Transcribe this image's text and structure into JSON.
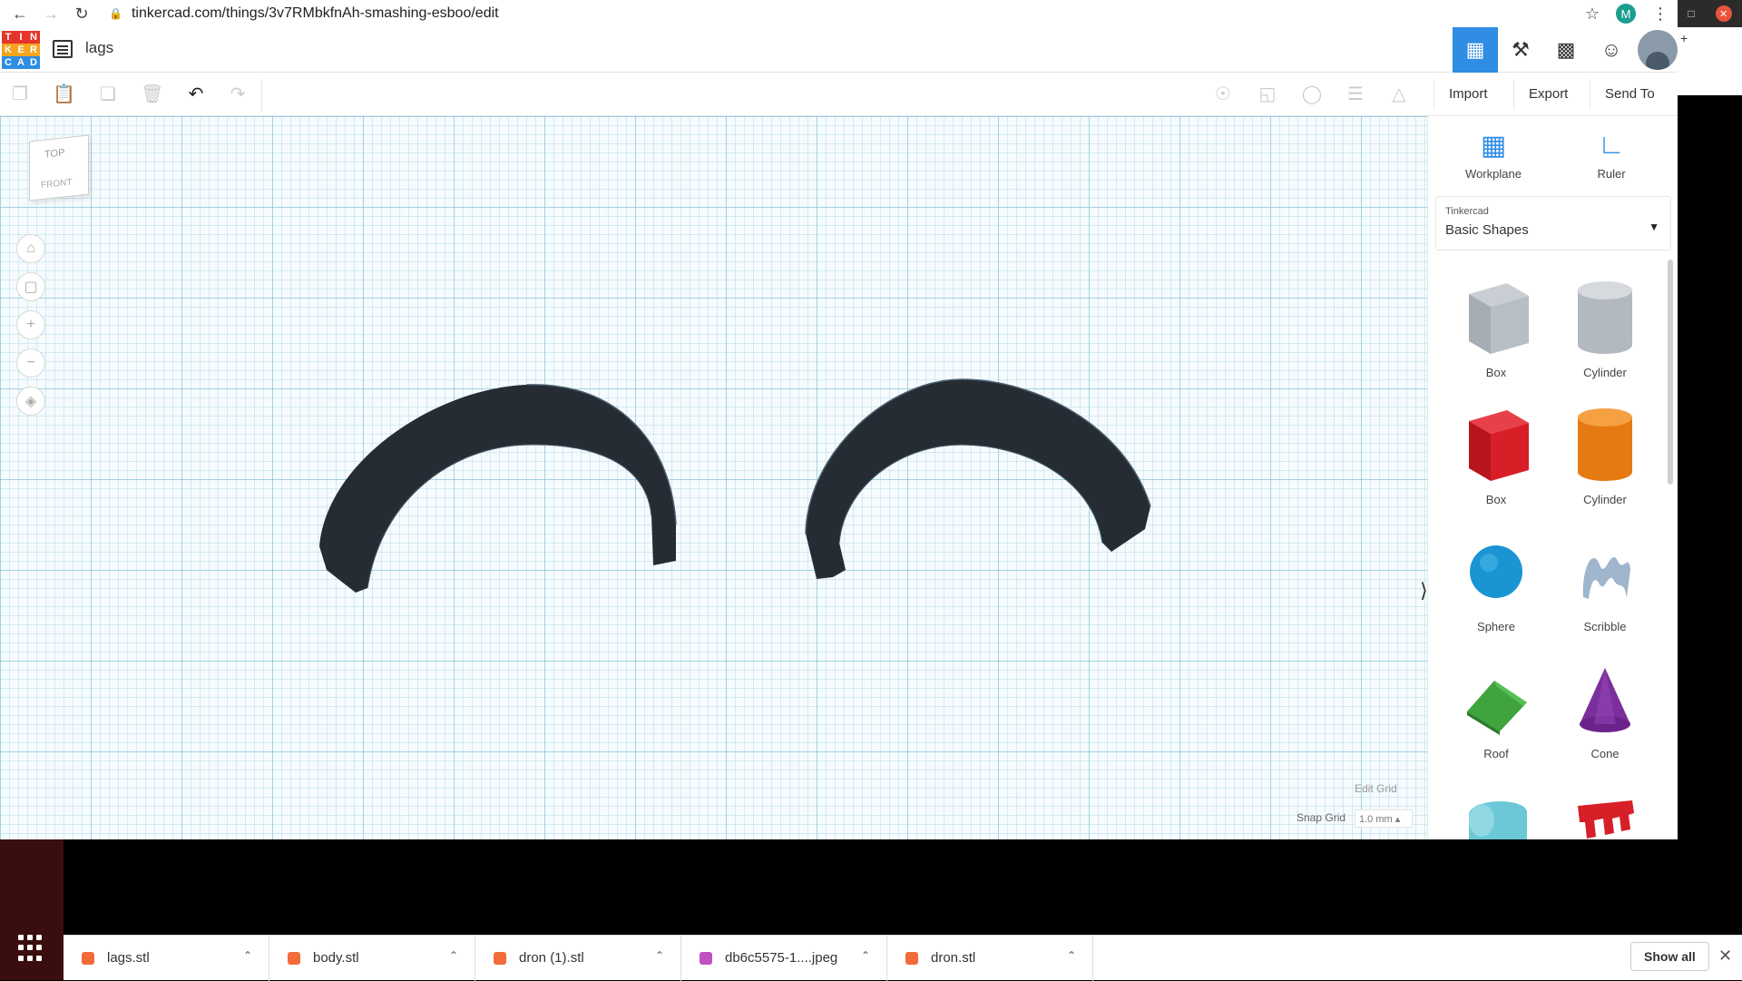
{
  "browser": {
    "url": "tinkercad.com/things/3v7RMbkfnAh-smashing-esboo/edit",
    "profile_initial": "M"
  },
  "header": {
    "logo_letters": [
      "T",
      "I",
      "N",
      "K",
      "E",
      "R",
      "C",
      "A",
      "D"
    ],
    "logo_colors": [
      "#e5352b",
      "#e5352b",
      "#e5352b",
      "#f4a41d",
      "#f4a41d",
      "#f4a41d",
      "#2f8de4",
      "#2f8de4",
      "#2f8de4"
    ],
    "doc_title": "lags"
  },
  "toolbar": {
    "import_label": "Import",
    "export_label": "Export",
    "send_to_label": "Send To"
  },
  "workplane": {
    "viewcube_top": "TOP",
    "viewcube_front": "FRONT",
    "edit_grid_label": "Edit Grid",
    "snap_grid_label": "Snap Grid",
    "snap_grid_value": "1.0 mm ▴",
    "shape_color": "#262c33"
  },
  "panel": {
    "workplane_label": "Workplane",
    "ruler_label": "Ruler",
    "library_source": "Tinkercad",
    "library_name": "Basic Shapes",
    "shapes": [
      {
        "label": "Box",
        "icon": "box-hole-icon"
      },
      {
        "label": "Cylinder",
        "icon": "cylinder-hole-icon"
      },
      {
        "label": "Box",
        "icon": "box-red-icon"
      },
      {
        "label": "Cylinder",
        "icon": "cylinder-orange-icon"
      },
      {
        "label": "Sphere",
        "icon": "sphere-icon"
      },
      {
        "label": "Scribble",
        "icon": "scribble-icon"
      },
      {
        "label": "Roof",
        "icon": "roof-icon"
      },
      {
        "label": "Cone",
        "icon": "cone-icon"
      },
      {
        "label": "",
        "icon": "round-roof-icon"
      },
      {
        "label": "",
        "icon": "text-icon"
      }
    ]
  },
  "downloads": {
    "items": [
      {
        "name": "lags.stl",
        "color": "#f26b3a"
      },
      {
        "name": "body.stl",
        "color": "#f26b3a"
      },
      {
        "name": "dron (1).stl",
        "color": "#f26b3a"
      },
      {
        "name": "db6c5575-1....jpeg",
        "color": "#c04fc0"
      },
      {
        "name": "dron.stl",
        "color": "#f26b3a"
      }
    ],
    "show_all_label": "Show all"
  }
}
